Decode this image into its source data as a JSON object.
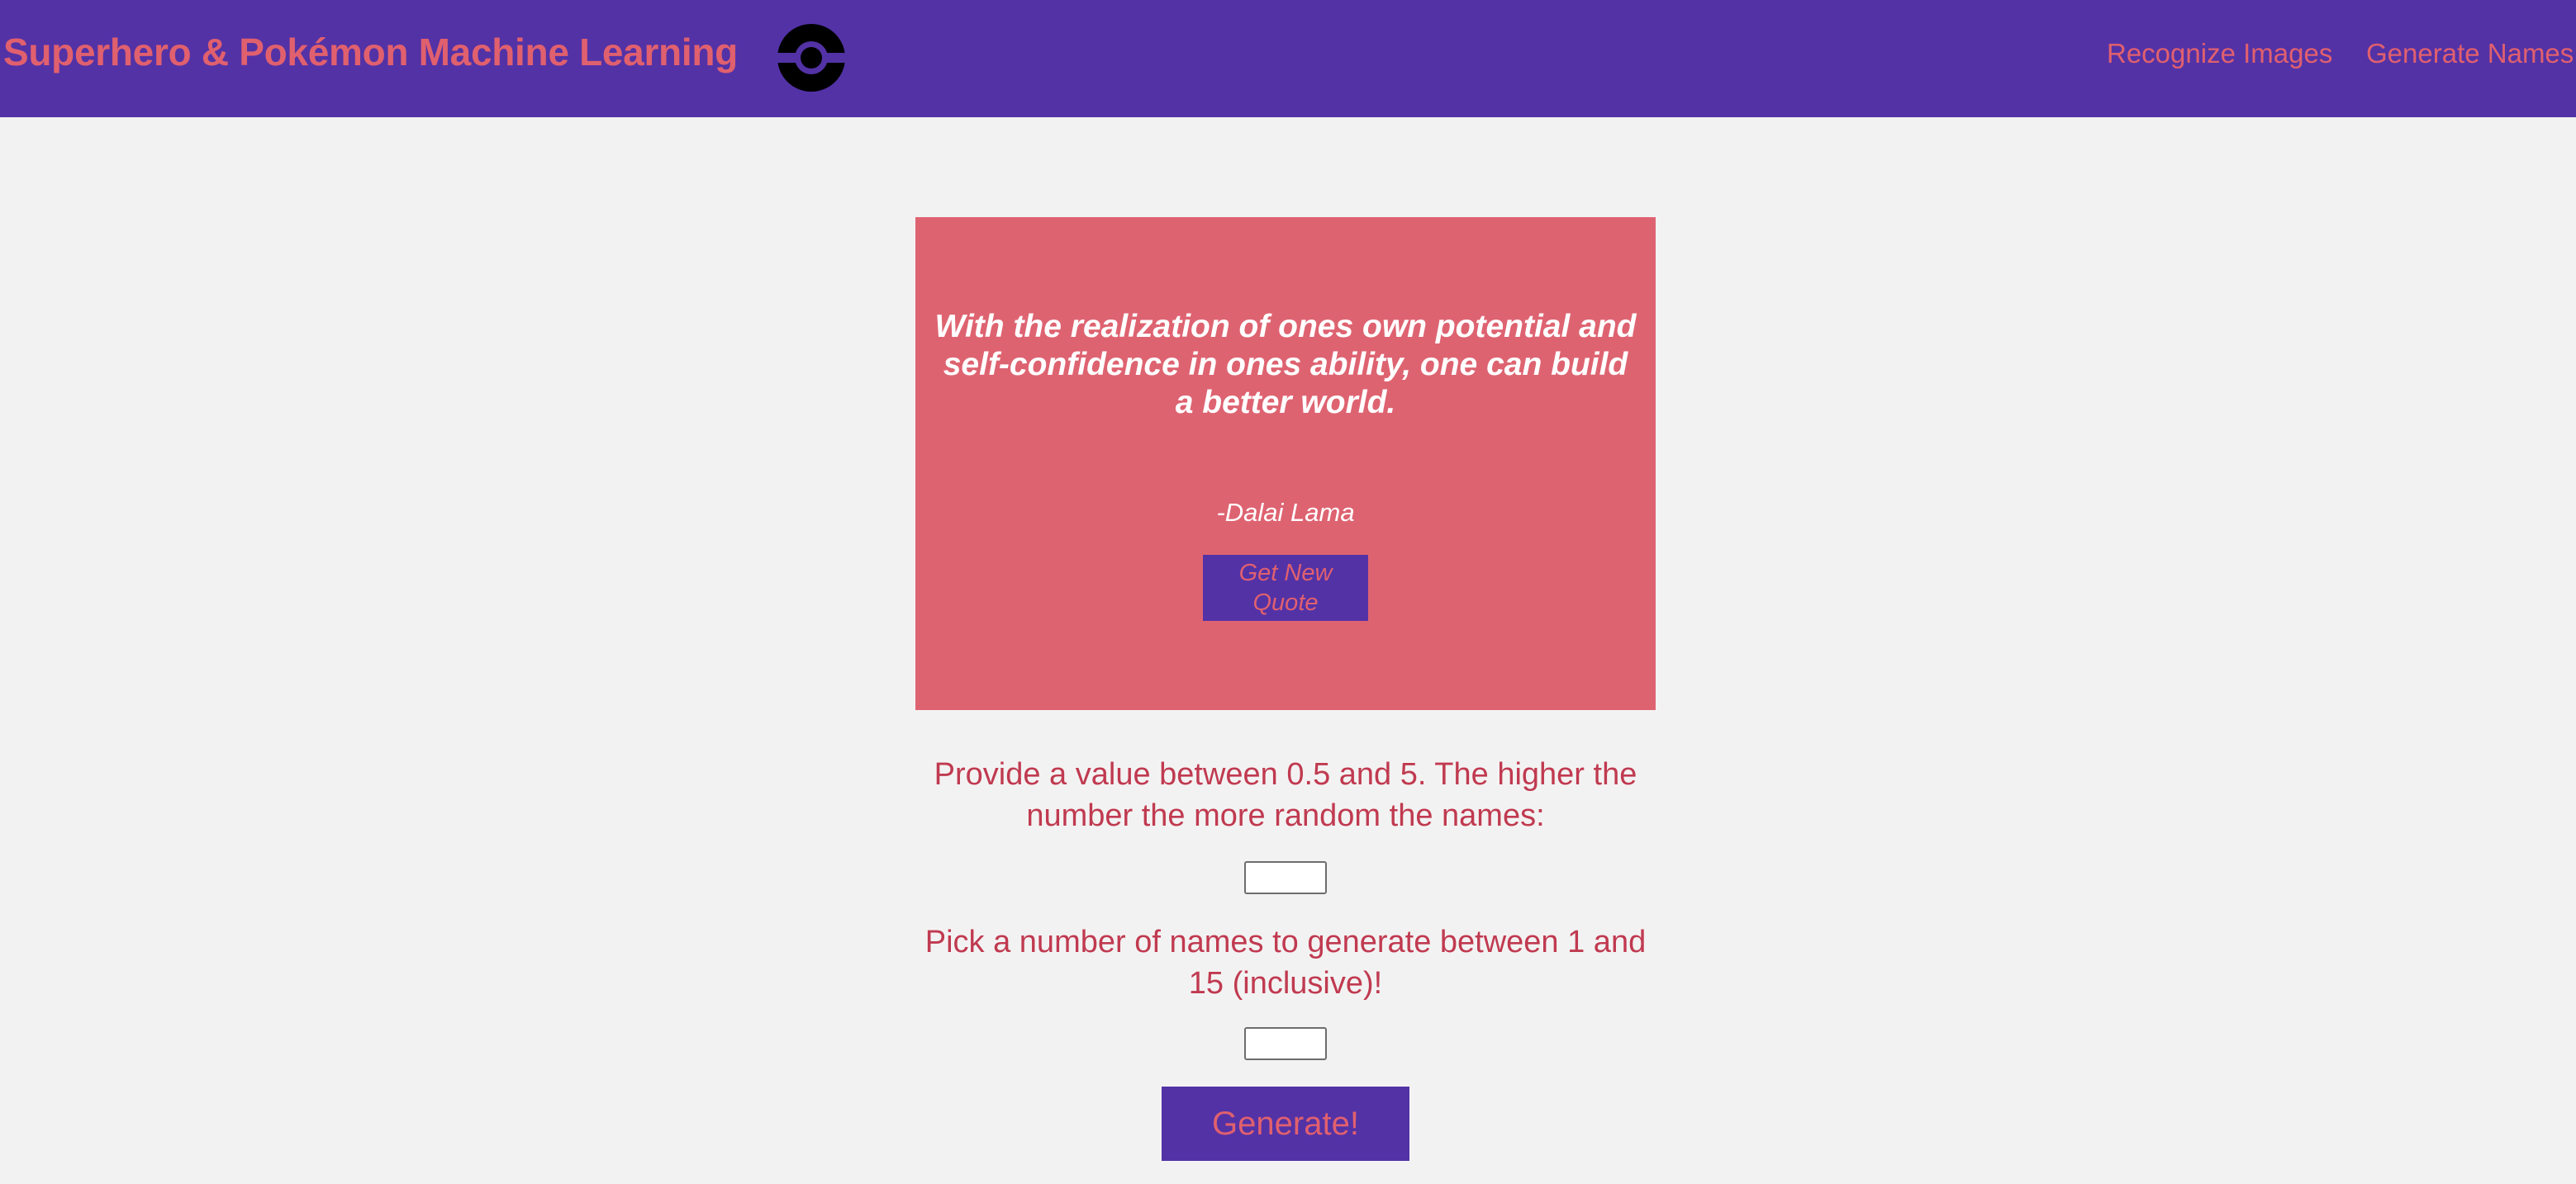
{
  "navbar": {
    "brand": "Superhero & Pokémon Machine Learning",
    "logo_icon": "pokeball-icon",
    "links": [
      {
        "label": "Recognize Images"
      },
      {
        "label": "Generate Names"
      }
    ]
  },
  "quote": {
    "text": "With the realization of ones own potential and self-confidence in ones ability, one can build a better world.",
    "author": "-Dalai Lama",
    "button_label": "Get New Quote"
  },
  "form": {
    "randomness_prompt": "Provide a value between 0.5 and 5. The higher the number the more random the names:",
    "randomness_value": "",
    "count_prompt": "Pick a number of names to generate between 1 and 15 (inclusive)!",
    "count_value": "",
    "generate_label": "Generate!"
  },
  "colors": {
    "navbar_bg": "#5332a6",
    "accent": "#e0606e",
    "quote_card_bg": "#de6371",
    "page_bg": "#f3f2f2",
    "prompt_text": "#c03a50"
  }
}
